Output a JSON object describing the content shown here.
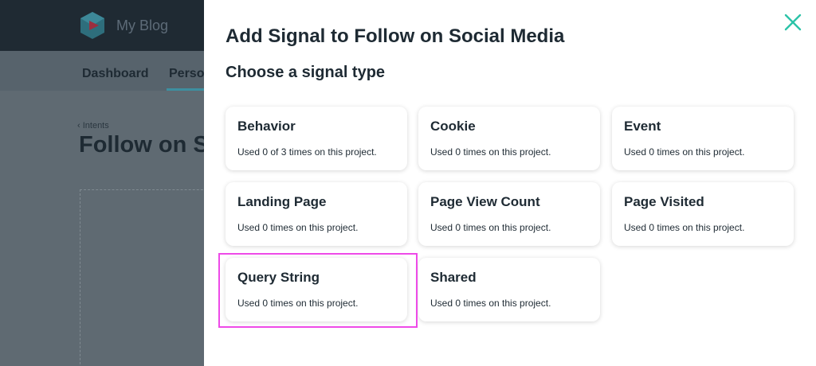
{
  "background": {
    "brand": "My Blog",
    "nav": [
      "Dashboard",
      "Perso"
    ],
    "breadcrumb": "‹ Intents",
    "page_title": "Follow on S"
  },
  "panel": {
    "title": "Add Signal to Follow on Social Media",
    "subtitle": "Choose a signal type",
    "close_icon": "close-icon",
    "accent_color": "#2cc3a8",
    "highlight_color": "#ee4ae8",
    "cards": [
      {
        "title": "Behavior",
        "desc": "Used 0 of 3 times on this project."
      },
      {
        "title": "Cookie",
        "desc": "Used 0 times on this project."
      },
      {
        "title": "Event",
        "desc": "Used 0 times on this project."
      },
      {
        "title": "Landing Page",
        "desc": "Used 0 times on this project."
      },
      {
        "title": "Page View Count",
        "desc": "Used 0 times on this project."
      },
      {
        "title": "Page Visited",
        "desc": "Used 0 times on this project."
      },
      {
        "title": "Query String",
        "desc": "Used 0 times on this project."
      },
      {
        "title": "Shared",
        "desc": "Used 0 times on this project."
      }
    ]
  }
}
